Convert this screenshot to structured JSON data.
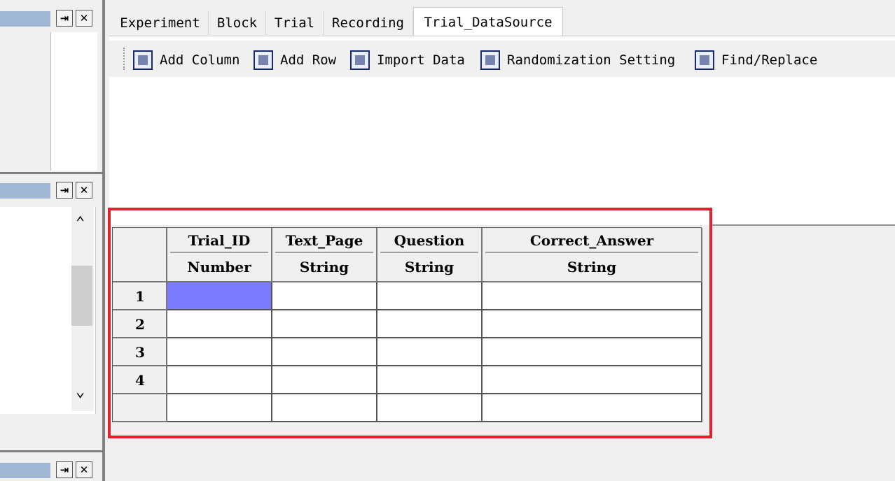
{
  "tabs": [
    {
      "label": "Experiment"
    },
    {
      "label": "Block"
    },
    {
      "label": "Trial"
    },
    {
      "label": "Recording"
    },
    {
      "label": "Trial_DataSource",
      "active": true
    }
  ],
  "toolbar": {
    "add_column": "Add Column",
    "add_row": "Add Row",
    "import_data": "Import Data",
    "randomization": "Randomization Setting",
    "find_replace": "Find/Replace"
  },
  "grid": {
    "columns": [
      {
        "name": "Trial_ID",
        "type": "Number"
      },
      {
        "name": "Text_Page",
        "type": "String"
      },
      {
        "name": "Question",
        "type": "String"
      },
      {
        "name": "Correct_Answer",
        "type": "String"
      }
    ],
    "row_numbers": [
      "1",
      "2",
      "3",
      "4",
      ""
    ],
    "selected_cell": {
      "row": 1,
      "column": "Trial_ID"
    }
  },
  "icons": {
    "pin": "pin-icon",
    "close": "close-icon",
    "scroll_up": "chevron-up-icon",
    "scroll_down": "chevron-down-icon"
  },
  "colors": {
    "panel_title": "#9fb6d4",
    "selected_cell": "#7b7bff",
    "highlight": "#e0212e"
  },
  "glyphs": {
    "pin": "⇥",
    "close": "✕",
    "up": "⌃",
    "down": "⌄"
  }
}
